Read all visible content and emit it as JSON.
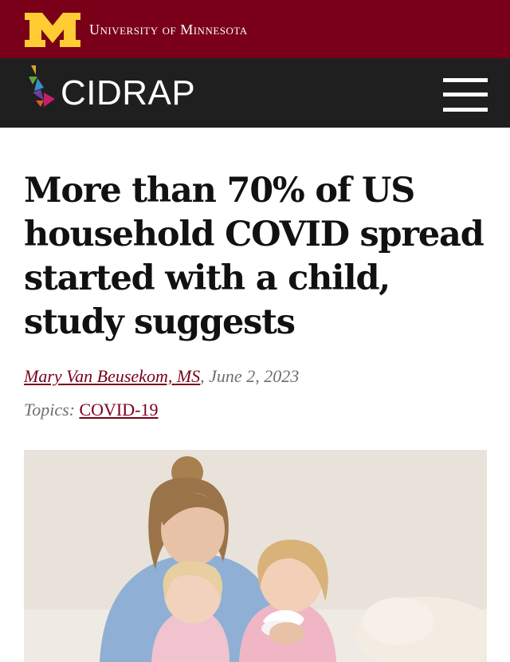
{
  "header": {
    "university_name": "University of Minnesota",
    "brand_colors": {
      "maroon": "#7a0019",
      "gold": "#ffcc33",
      "dark": "#1f1f1f"
    }
  },
  "nav": {
    "site_name": "CIDRAP",
    "menu_icon": "hamburger-menu-icon"
  },
  "article": {
    "headline": "More than 70% of US household COVID spread started with a child, study suggests",
    "author": "Mary Van Beusekom, MS",
    "author_separator": ",",
    "date": "June 2, 2023",
    "topics_label": "Topics:",
    "topic": "COVID-19"
  }
}
